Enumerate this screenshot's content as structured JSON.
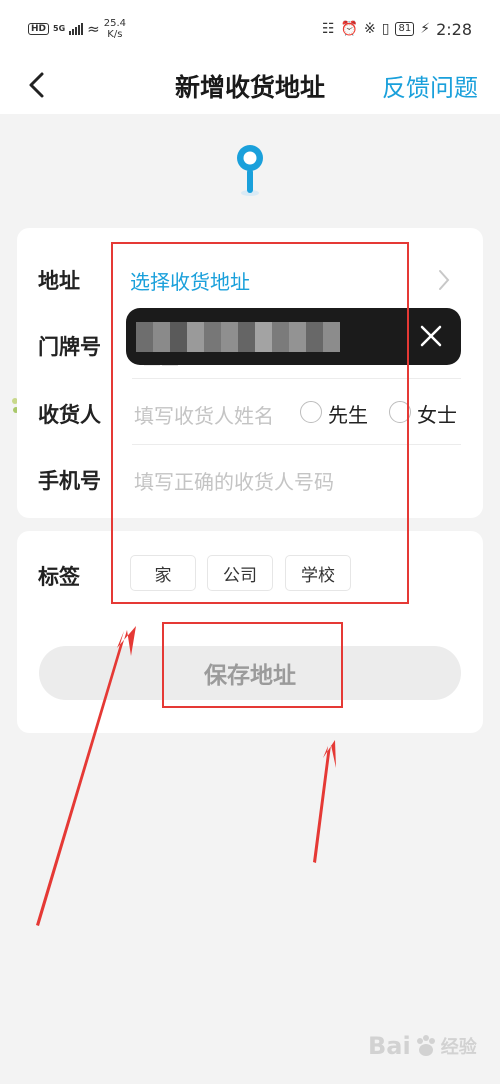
{
  "status_bar": {
    "hd": "HD",
    "network": "5G",
    "speed_value": "25.4",
    "speed_unit": "K/s",
    "battery": "81",
    "time": "2:28"
  },
  "header": {
    "title": "新增收货地址",
    "feedback_label": "反馈问题"
  },
  "form": {
    "address_label": "地址",
    "address_value": "选择收货地址",
    "door_label": "门牌号",
    "recipient_label": "收货人",
    "recipient_placeholder": "填写收货人姓名",
    "gender_options": [
      "先生",
      "女士"
    ],
    "phone_label": "手机号",
    "phone_placeholder": "填写正确的收货人号码"
  },
  "tags": {
    "label": "标签",
    "options": [
      "家",
      "公司",
      "学校"
    ]
  },
  "save_label": "保存地址",
  "watermark": {
    "brand": "Bai",
    "suffix": "经验"
  },
  "colors": {
    "accent": "#1aa0db",
    "annotation": "#e53935",
    "background": "#f3f3f3"
  },
  "icons": [
    "back-icon",
    "feedback-link",
    "location-pin-icon",
    "chevron-right-icon",
    "close-icon",
    "paw-icon"
  ]
}
